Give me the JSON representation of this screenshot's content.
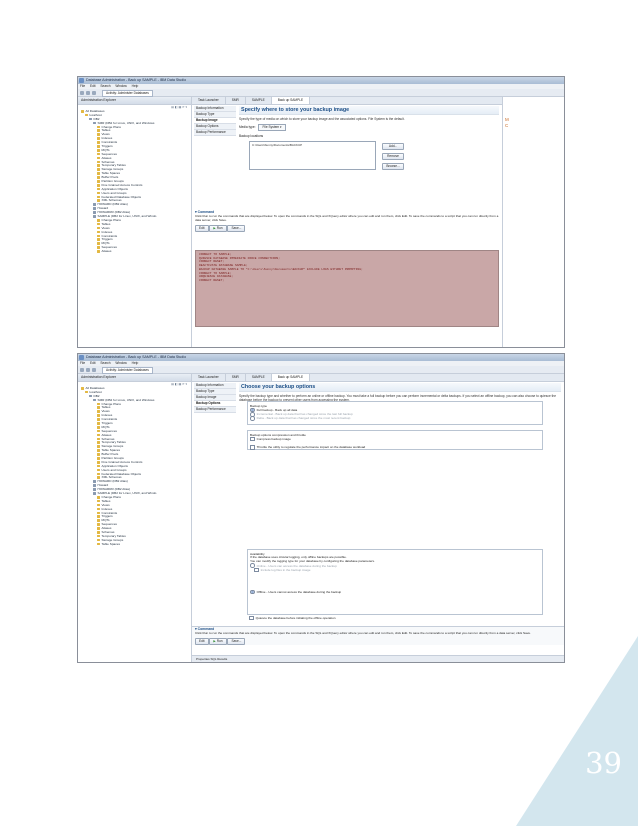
{
  "page_number": "39",
  "corner_color": "#d3e6ee",
  "screenshot1": {
    "window_title": "Database Administration - Back up SAMPLE - IBM Data Studio",
    "menu": [
      "File",
      "Edit",
      "Search",
      "Window",
      "Help"
    ],
    "activity": "Activity: Administer Databases",
    "explorer_title": "Administration Explorer",
    "tree": [
      {
        "label": "All Databases",
        "indent": 0,
        "type": "folder"
      },
      {
        "label": "localhost",
        "indent": 1,
        "type": "folder"
      },
      {
        "label": "DB2",
        "indent": 2,
        "type": "db"
      },
      {
        "label": "SMR (DB2 for Linux, UNIX, and Windows",
        "indent": 3,
        "type": "db"
      },
      {
        "label": "Change Plans",
        "indent": 4,
        "type": "folder"
      },
      {
        "label": "Tables",
        "indent": 4,
        "type": "folder"
      },
      {
        "label": "Views",
        "indent": 4,
        "type": "folder"
      },
      {
        "label": "Indexes",
        "indent": 4,
        "type": "folder"
      },
      {
        "label": "Constraints",
        "indent": 4,
        "type": "folder"
      },
      {
        "label": "Triggers",
        "indent": 4,
        "type": "folder"
      },
      {
        "label": "MQTs",
        "indent": 4,
        "type": "folder"
      },
      {
        "label": "Sequences",
        "indent": 4,
        "type": "folder"
      },
      {
        "label": "Aliases",
        "indent": 4,
        "type": "folder"
      },
      {
        "label": "Schemas",
        "indent": 4,
        "type": "folder"
      },
      {
        "label": "Temporary Tables",
        "indent": 4,
        "type": "folder"
      },
      {
        "label": "Storage Groups",
        "indent": 4,
        "type": "folder"
      },
      {
        "label": "Table Spaces",
        "indent": 4,
        "type": "folder"
      },
      {
        "label": "Buffer Pools",
        "indent": 4,
        "type": "folder"
      },
      {
        "label": "Partition Groups",
        "indent": 4,
        "type": "folder"
      },
      {
        "label": "Fine Grained Access Controls",
        "indent": 4,
        "type": "folder"
      },
      {
        "label": "Application Objects",
        "indent": 4,
        "type": "folder"
      },
      {
        "label": "Users and Groups",
        "indent": 4,
        "type": "folder"
      },
      {
        "label": "Federated Database Objects",
        "indent": 4,
        "type": "folder"
      },
      {
        "label": "XML Schemas",
        "indent": 4,
        "type": "folder"
      },
      {
        "label": "HOWARD (DB2 Alias)",
        "indent": 3,
        "type": "db"
      },
      {
        "label": "Howard",
        "indent": 3,
        "type": "db"
      },
      {
        "label": "HOWARRR (DB2 Alias)",
        "indent": 3,
        "type": "db"
      },
      {
        "label": "SAMPLE (DB2 for Linux, UNIX, and Windo",
        "indent": 3,
        "type": "db"
      },
      {
        "label": "Change Plans",
        "indent": 4,
        "type": "folder"
      },
      {
        "label": "Tables",
        "indent": 4,
        "type": "folder"
      },
      {
        "label": "Views",
        "indent": 4,
        "type": "folder"
      },
      {
        "label": "Indexes",
        "indent": 4,
        "type": "folder"
      },
      {
        "label": "Constraints",
        "indent": 4,
        "type": "folder"
      },
      {
        "label": "Triggers",
        "indent": 4,
        "type": "folder"
      },
      {
        "label": "MQTs",
        "indent": 4,
        "type": "folder"
      },
      {
        "label": "Sequences",
        "indent": 4,
        "type": "folder"
      },
      {
        "label": "Aliases",
        "indent": 4,
        "type": "folder"
      }
    ],
    "tabs": [
      "Task Launcher",
      "SMR",
      "SAMPLE",
      "Back up SAMPLE"
    ],
    "nav": [
      "Backup Information",
      "Backup Type",
      "Backup Image",
      "Backup Options",
      "Backup Performance"
    ],
    "nav_selected": 2,
    "heading": "Specify where to store your backup image",
    "description": "Specify the type of media on which to store your backup image and the associated options. File System is the default.",
    "media_type_label": "Media type:",
    "media_type_value": "File System",
    "backup_locations_label": "Backup locations",
    "backup_location_item": "C:\\Users\\Sunny\\Documents\\BACKUP",
    "buttons": [
      "Add...",
      "Remove",
      "Browse..."
    ],
    "command_label": "Command",
    "command_desc": "Click Run to run the commands that are displayed below. To open the commands in the SQL and XQuery editor where you can edit and run them, click Edit. To save the commands to a script that you can run directly from a data server, click Save.",
    "command_buttons": [
      "Edit",
      "Run",
      "Save..."
    ],
    "command_lines": [
      "CONNECT TO SAMPLE;",
      "QUIESCE DATABASE IMMEDIATE FORCE CONNECTIONS;",
      "CONNECT RESET;",
      "DEACTIVATE DATABASE SAMPLE;",
      "BACKUP DATABASE SAMPLE TO \"C:\\Users\\Sunny\\Documents\\BACKUP\" EXCLUDE LOGS WITHOUT PROMPTING;",
      "CONNECT TO SAMPLE;",
      "UNQUIESCE DATABASE;",
      "CONNECT RESET;"
    ],
    "right_letters": [
      "M",
      "C"
    ]
  },
  "screenshot2": {
    "window_title": "Database Administration - Back up SAMPLE - IBM Data Studio",
    "menu": [
      "File",
      "Edit",
      "Search",
      "Window",
      "Help"
    ],
    "activity": "Activity: Administer Databases",
    "explorer_title": "Administration Explorer",
    "tree": [
      {
        "label": "All Databases",
        "indent": 0,
        "type": "folder"
      },
      {
        "label": "localhost",
        "indent": 1,
        "type": "folder"
      },
      {
        "label": "DB2",
        "indent": 2,
        "type": "db"
      },
      {
        "label": "SMR (DB2 for Linux, UNIX, and Windows",
        "indent": 3,
        "type": "db"
      },
      {
        "label": "Change Plans",
        "indent": 4,
        "type": "folder"
      },
      {
        "label": "Tables",
        "indent": 4,
        "type": "folder"
      },
      {
        "label": "Views",
        "indent": 4,
        "type": "folder"
      },
      {
        "label": "Indexes",
        "indent": 4,
        "type": "folder"
      },
      {
        "label": "Constraints",
        "indent": 4,
        "type": "folder"
      },
      {
        "label": "Triggers",
        "indent": 4,
        "type": "folder"
      },
      {
        "label": "MQTs",
        "indent": 4,
        "type": "folder"
      },
      {
        "label": "Sequences",
        "indent": 4,
        "type": "folder"
      },
      {
        "label": "Aliases",
        "indent": 4,
        "type": "folder"
      },
      {
        "label": "Schemas",
        "indent": 4,
        "type": "folder"
      },
      {
        "label": "Temporary Tables",
        "indent": 4,
        "type": "folder"
      },
      {
        "label": "Storage Groups",
        "indent": 4,
        "type": "folder"
      },
      {
        "label": "Table Spaces",
        "indent": 4,
        "type": "folder"
      },
      {
        "label": "Buffer Pools",
        "indent": 4,
        "type": "folder"
      },
      {
        "label": "Partition Groups",
        "indent": 4,
        "type": "folder"
      },
      {
        "label": "Fine Grained Access Controls",
        "indent": 4,
        "type": "folder"
      },
      {
        "label": "Application Objects",
        "indent": 4,
        "type": "folder"
      },
      {
        "label": "Users and Groups",
        "indent": 4,
        "type": "folder"
      },
      {
        "label": "Federated Database Objects",
        "indent": 4,
        "type": "folder"
      },
      {
        "label": "XML Schemas",
        "indent": 4,
        "type": "folder"
      },
      {
        "label": "HOWARD (DB2 Alias)",
        "indent": 3,
        "type": "db"
      },
      {
        "label": "Howard",
        "indent": 3,
        "type": "db"
      },
      {
        "label": "HOWARRR (DB2 Alias)",
        "indent": 3,
        "type": "db"
      },
      {
        "label": "SAMPLE (DB2 for Linux, UNIX, and Windo",
        "indent": 3,
        "type": "db"
      },
      {
        "label": "Change Plans",
        "indent": 4,
        "type": "folder"
      },
      {
        "label": "Tables",
        "indent": 4,
        "type": "folder"
      },
      {
        "label": "Views",
        "indent": 4,
        "type": "folder"
      },
      {
        "label": "Indexes",
        "indent": 4,
        "type": "folder"
      },
      {
        "label": "Constraints",
        "indent": 4,
        "type": "folder"
      },
      {
        "label": "Triggers",
        "indent": 4,
        "type": "folder"
      },
      {
        "label": "MQTs",
        "indent": 4,
        "type": "folder"
      },
      {
        "label": "Sequences",
        "indent": 4,
        "type": "folder"
      },
      {
        "label": "Aliases",
        "indent": 4,
        "type": "folder"
      },
      {
        "label": "Schemas",
        "indent": 4,
        "type": "folder"
      },
      {
        "label": "Temporary Tables",
        "indent": 4,
        "type": "folder"
      },
      {
        "label": "Storage Groups",
        "indent": 4,
        "type": "folder"
      },
      {
        "label": "Table Spaces",
        "indent": 4,
        "type": "folder"
      }
    ],
    "tabs": [
      "Task Launcher",
      "SMR",
      "SAMPLE",
      "Back up SAMPLE"
    ],
    "nav": [
      "Backup Information",
      "Backup Type",
      "Backup Image",
      "Backup Options",
      "Backup Performance"
    ],
    "nav_selected": 3,
    "heading": "Choose your backup options",
    "description": "Specify the backup type and whether to perform an online or offline backup. You must take a full backup before you can perform incremental or delta backups. If you select an offline backup, you can also choose to quiesce the database before the backup to prevent other users from accessing the system.",
    "backup_type_label": "Backup type",
    "backup_type_options": [
      {
        "label": "Full backup - Back up all data",
        "selected": true,
        "enabled": true
      },
      {
        "label": "Incremental - Back up data that has changed since the last full backup",
        "selected": false,
        "enabled": false
      },
      {
        "label": "Delta - Back up data that has changed since the most recent backup",
        "selected": false,
        "enabled": false
      }
    ],
    "compression_label": "Backup options compression and throttle",
    "compress_option": "Compress backup image",
    "throttle_option": "Throttle the utility to regulate the performance impact on the database workload",
    "availability_label": "Availability",
    "availability_desc1": "If the database uses circular logging, only offline backups are possible.",
    "availability_desc2": "You can modify the logging type for your database by configuring the database parameters.",
    "online_option": "Online - Users can access the database during the backup",
    "include_logs_option": "Include log files in the backup image",
    "offline_option": "Offline - Users cannot access the database during the backup",
    "quiesce_option": "Quiesce the database before initiating the offline operation",
    "command_label": "Command",
    "command_desc": "Click Run to run the commands that are displayed below. To open the commands in the SQL and XQuery editor where you can edit and run them, click Edit. To save the commands to a script that you can run directly from a data server, click Save.",
    "command_buttons": [
      "Edit",
      "Run",
      "Save..."
    ],
    "status_tabs": "Properties   SQL Results"
  }
}
